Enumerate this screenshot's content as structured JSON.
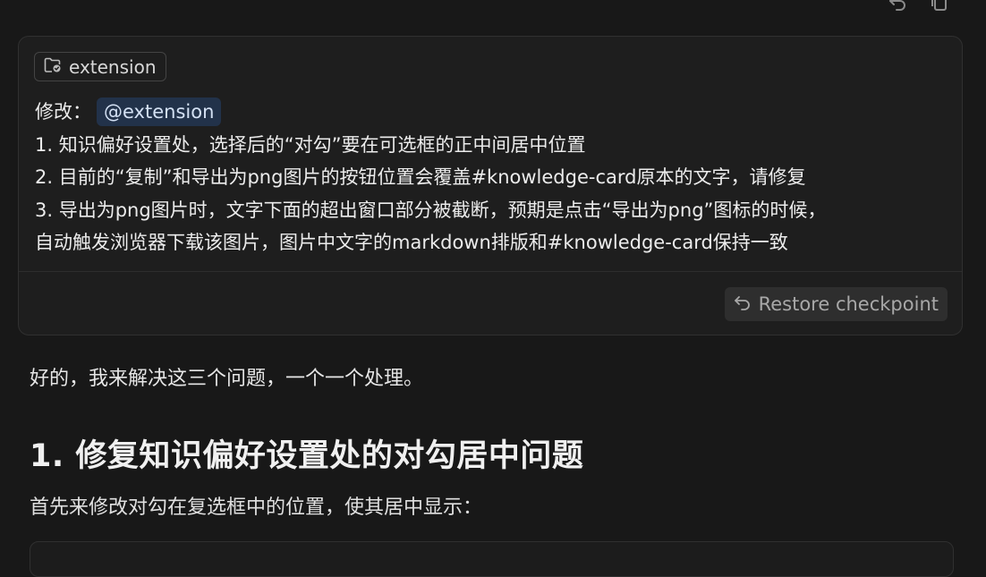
{
  "toolbar": {
    "undo_icon": "undo-icon",
    "copy_icon": "copy-icon"
  },
  "user_message": {
    "context_chip": {
      "icon": "folder-icon",
      "label": "extension"
    },
    "prefix": "修改：",
    "mention": "@extension",
    "lines": [
      "1. 知识偏好设置处，选择后的“对勾”要在可选框的正中间居中位置",
      "2. 目前的“复制”和导出为png图片的按钮位置会覆盖#knowledge-card原本的文字，请修复",
      "3. 导出为png图片时，文字下面的超出窗口部分被截断，预期是点击“导出为png”图标的时候，",
      "自动触发浏览器下载该图片，图片中文字的markdown排版和#knowledge-card保持一致"
    ],
    "restore_button": {
      "icon": "restore-icon",
      "label": "Restore checkpoint"
    }
  },
  "assistant_reply": {
    "intro": "好的，我来解决这三个问题，一个一个处理。",
    "heading": "1. 修复知识偏好设置处的对勾居中问题",
    "paragraph": "首先来修改对勾在复选框中的位置，使其居中显示："
  },
  "colors": {
    "background": "#181818",
    "card": "#1e1e1e",
    "mention_bg": "#22324a",
    "text": "#e6e6e6",
    "muted": "#a8a8a8"
  }
}
